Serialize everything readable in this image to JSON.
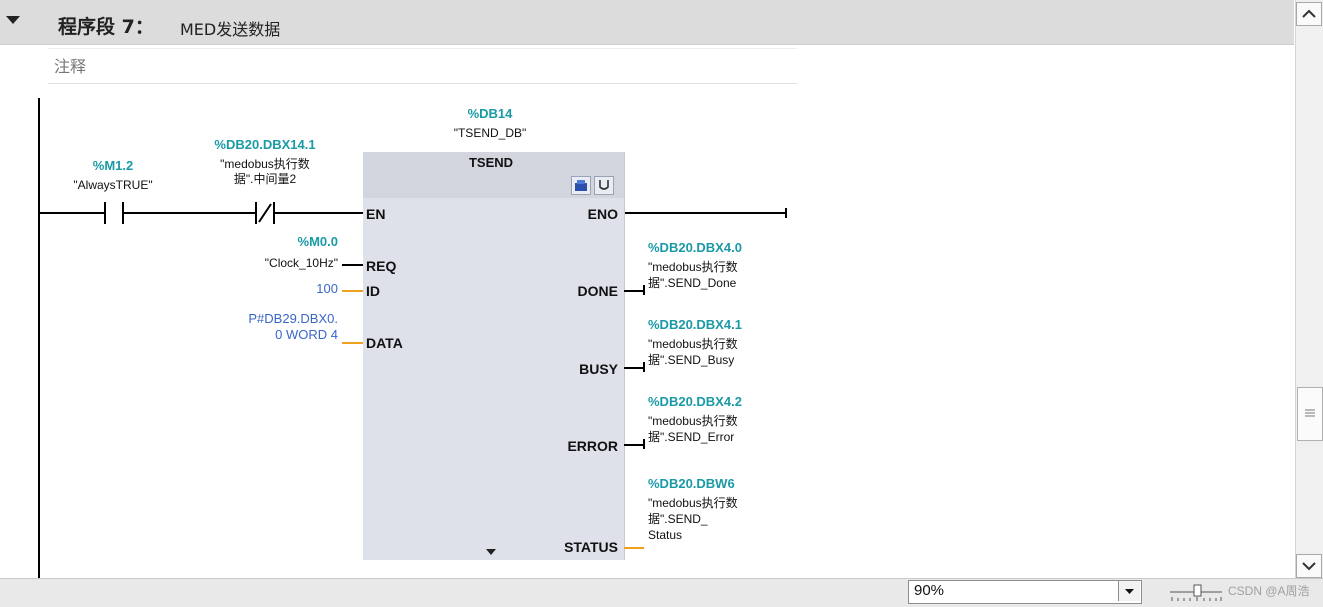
{
  "network": {
    "label": "程序段 7：",
    "title": "MED发送数据",
    "comment": "注释"
  },
  "contact_no": {
    "address": "%M1.2",
    "name": "\"AlwaysTRUE\""
  },
  "contact_nc": {
    "address": "%DB20.DBX14.1",
    "name_line1": "\"medobus执行数",
    "name_line2": "据\".中间量2"
  },
  "block": {
    "instance_address": "%DB14",
    "instance_name": "\"TSEND_DB\"",
    "type": "TSEND",
    "pins_in": [
      "EN",
      "REQ",
      "ID",
      "DATA"
    ],
    "pins_out": [
      "ENO",
      "DONE",
      "BUSY",
      "ERROR",
      "STATUS"
    ]
  },
  "inputs": {
    "req_address": "%M0.0",
    "req_name": "\"Clock_10Hz\"",
    "id_value": "100",
    "data_line1": "P#DB29.DBX0.",
    "data_line2": "0 WORD 4"
  },
  "outputs": {
    "done_address": "%DB20.DBX4.0",
    "done_line1": "\"medobus执行数",
    "done_line2": "据\".SEND_Done",
    "busy_address": "%DB20.DBX4.1",
    "busy_line1": "\"medobus执行数",
    "busy_line2": "据\".SEND_Busy",
    "error_address": "%DB20.DBX4.2",
    "error_line1": "\"medobus执行数",
    "error_line2": "据\".SEND_Error",
    "status_address": "%DB20.DBW6",
    "status_line1": "\"medobus执行数",
    "status_line2": "据\".SEND_",
    "status_line3": "Status"
  },
  "statusbar": {
    "zoom": "90%",
    "watermark": "CSDN @A周浩"
  },
  "colors": {
    "address": "#1a9aa6",
    "constant": "#3a66c8",
    "wire": "#000000",
    "param_wire": "#f0a020",
    "block_body": "#dfe1ea"
  },
  "icons": [
    "collapse-triangle-icon",
    "block-online-icon",
    "block-checksum-icon",
    "scroll-up-icon",
    "scroll-down-icon",
    "scroll-grip-icon",
    "dropdown-arrow-icon",
    "zoom-slider-icon"
  ]
}
